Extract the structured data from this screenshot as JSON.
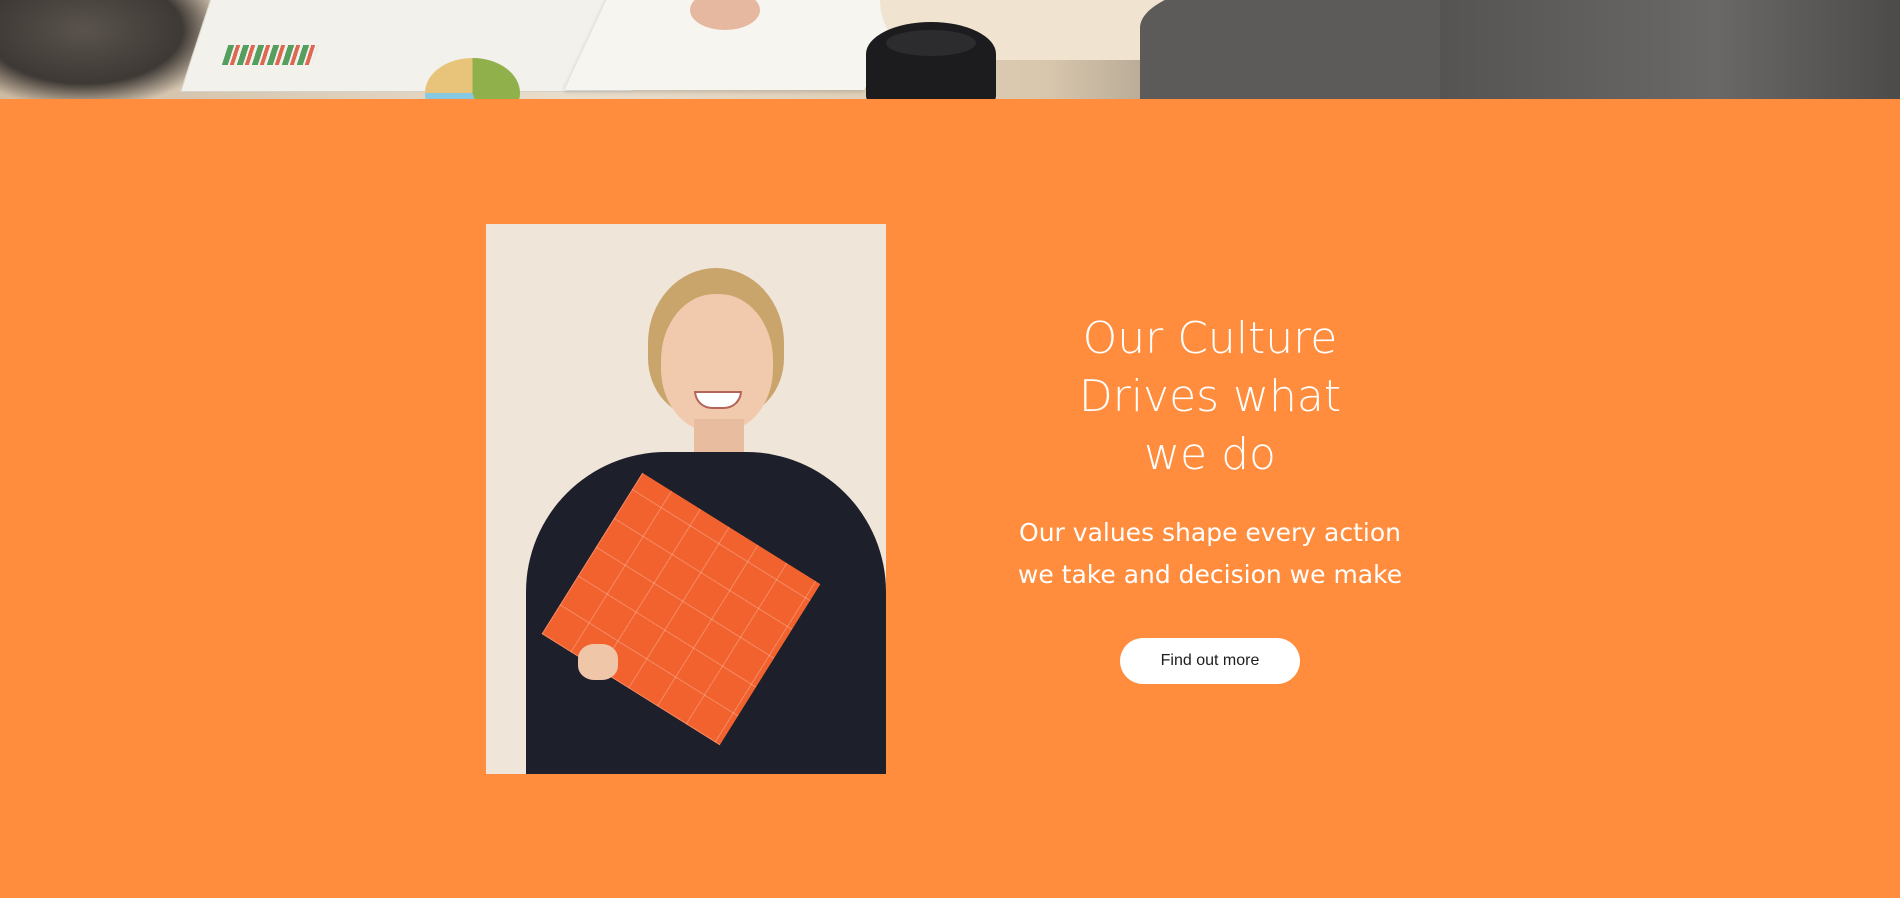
{
  "colors": {
    "background": "#ff8d3d",
    "text": "#ffffff",
    "button_bg": "#ffffff",
    "button_text": "#1d1d1d"
  },
  "hero_image": {
    "description_icon": "meeting-photo"
  },
  "culture_section": {
    "title": "Our Culture\nDrives what\nwe do",
    "subtitle": "Our values shape every action we take and decision we make",
    "cta_label": "Find out more"
  },
  "portrait_image": {
    "icon": "portrait-photo"
  }
}
